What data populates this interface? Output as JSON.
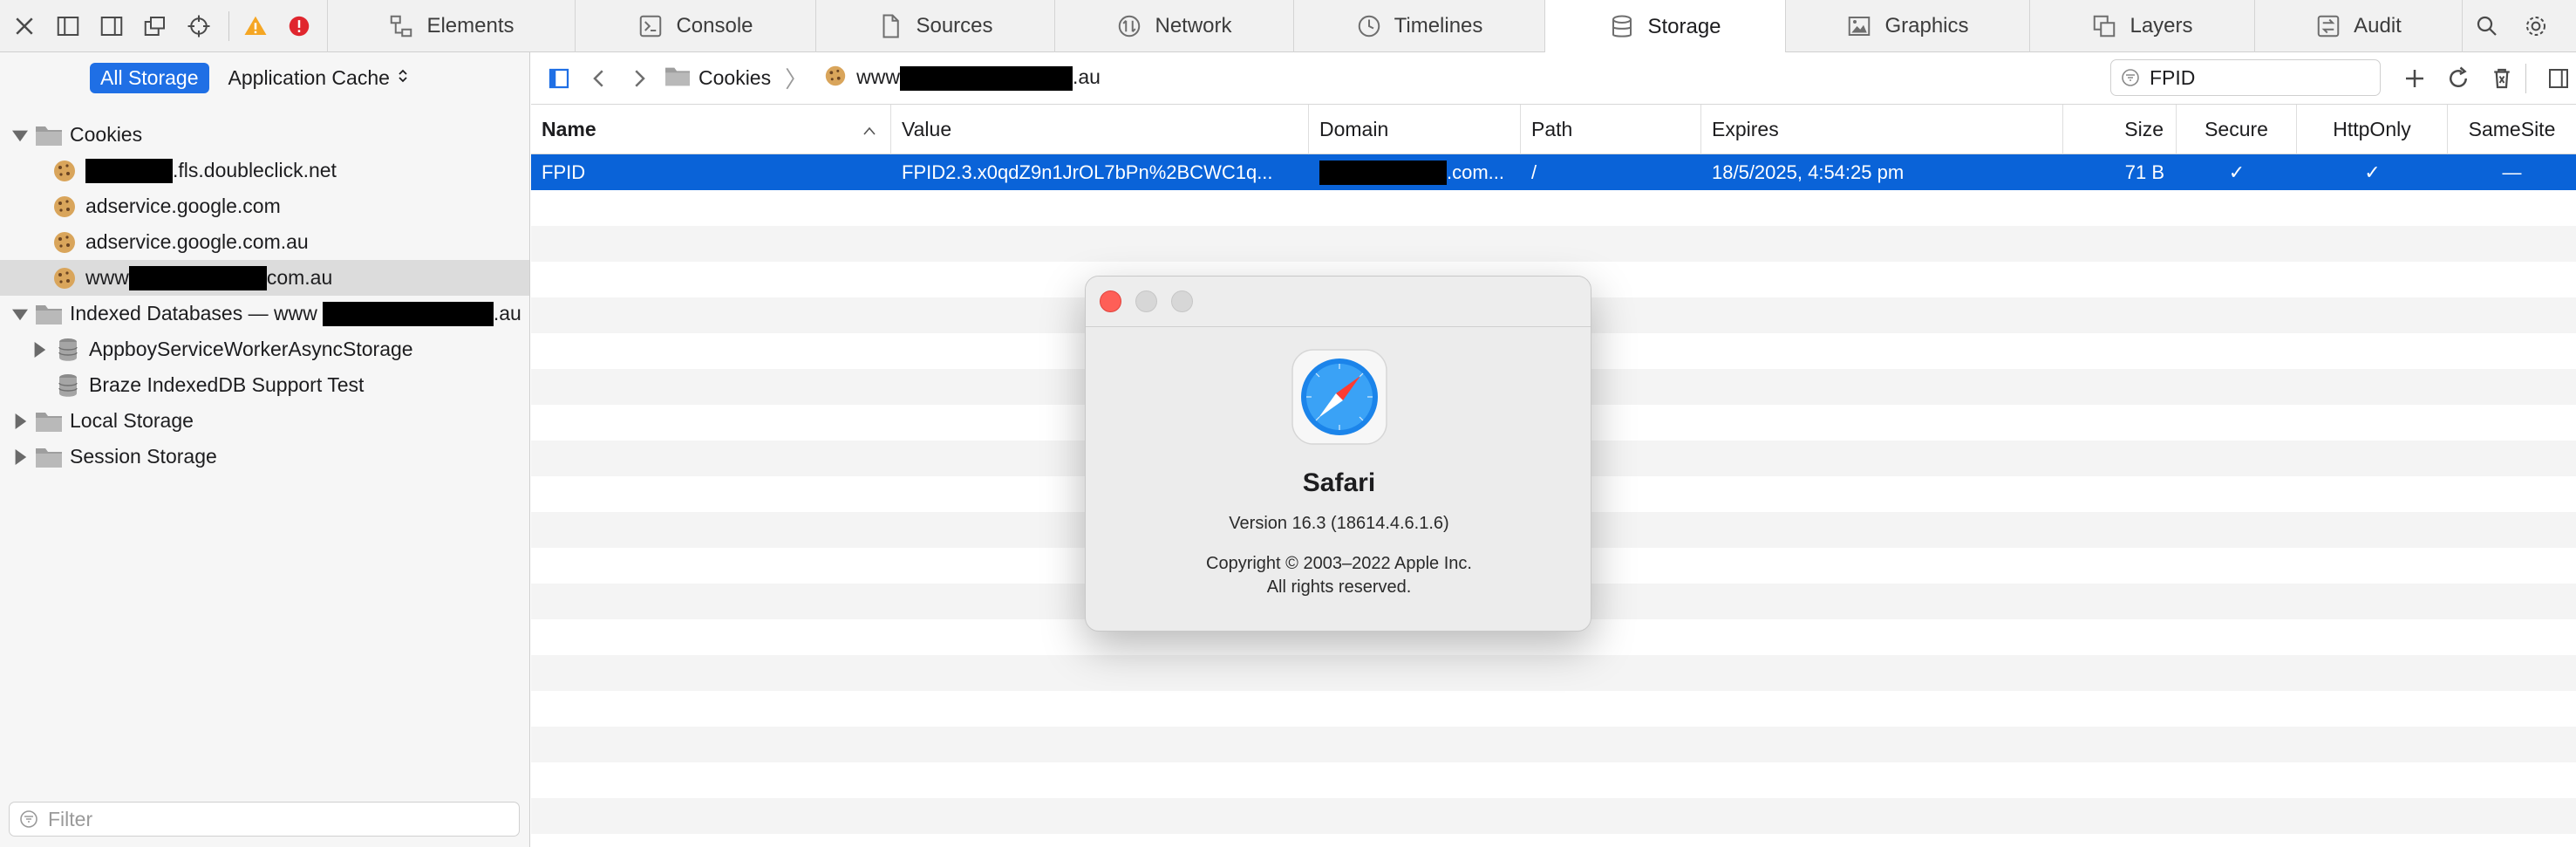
{
  "tabs": [
    {
      "label": "Elements",
      "icon": "elements-icon"
    },
    {
      "label": "Console",
      "icon": "console-icon"
    },
    {
      "label": "Sources",
      "icon": "sources-icon"
    },
    {
      "label": "Network",
      "icon": "network-icon"
    },
    {
      "label": "Timelines",
      "icon": "timelines-icon"
    },
    {
      "label": "Storage",
      "icon": "storage-icon",
      "active": true
    },
    {
      "label": "Graphics",
      "icon": "graphics-icon"
    },
    {
      "label": "Layers",
      "icon": "layers-icon"
    },
    {
      "label": "Audit",
      "icon": "audit-icon"
    }
  ],
  "sidebar": {
    "scope_active": "All Storage",
    "scope_other": "Application Cache",
    "tree": {
      "cookies": "Cookies",
      "cookie_items": [
        {
          "prefix": "",
          "suffix": ".fls.doubleclick.net"
        },
        {
          "prefix": "adservice.google.com",
          "suffix": ""
        },
        {
          "prefix": "adservice.google.com.au",
          "suffix": ""
        },
        {
          "prefix": "www",
          "suffix": "com.au"
        }
      ],
      "indexed_db": "Indexed Databases — www",
      "indexed_db_suffix": ".au",
      "indexed_items": [
        "AppboyServiceWorkerAsyncStorage",
        "Braze IndexedDB Support Test"
      ],
      "local_storage": "Local Storage",
      "session_storage": "Session Storage"
    },
    "filter_placeholder": "Filter"
  },
  "breadcrumb": {
    "root": "Cookies",
    "host_prefix": "www",
    "host_suffix": ".au"
  },
  "search": {
    "value": "FPID"
  },
  "table": {
    "columns": [
      "Name",
      "Value",
      "Domain",
      "Path",
      "Expires",
      "Size",
      "Secure",
      "HttpOnly",
      "SameSite"
    ],
    "selected_row": {
      "name": "FPID",
      "value": "FPID2.3.x0qdZ9n1JrOL7bPn%2BCWC1q...",
      "domain_suffix": ".com...",
      "path": "/",
      "expires": "18/5/2025, 4:54:25 pm",
      "size": "71 B",
      "secure": "✓",
      "httponly": "✓",
      "samesite": "—"
    }
  },
  "about": {
    "app_name": "Safari",
    "version": "Version 16.3 (18614.4.6.1.6)",
    "copyright": "Copyright © 2003–2022 Apple Inc.",
    "rights": "All rights reserved."
  },
  "colors": {
    "selection": "#0a63d8",
    "accent": "#1f6fe5",
    "warning": "#f5a623",
    "error": "#e0262e"
  }
}
